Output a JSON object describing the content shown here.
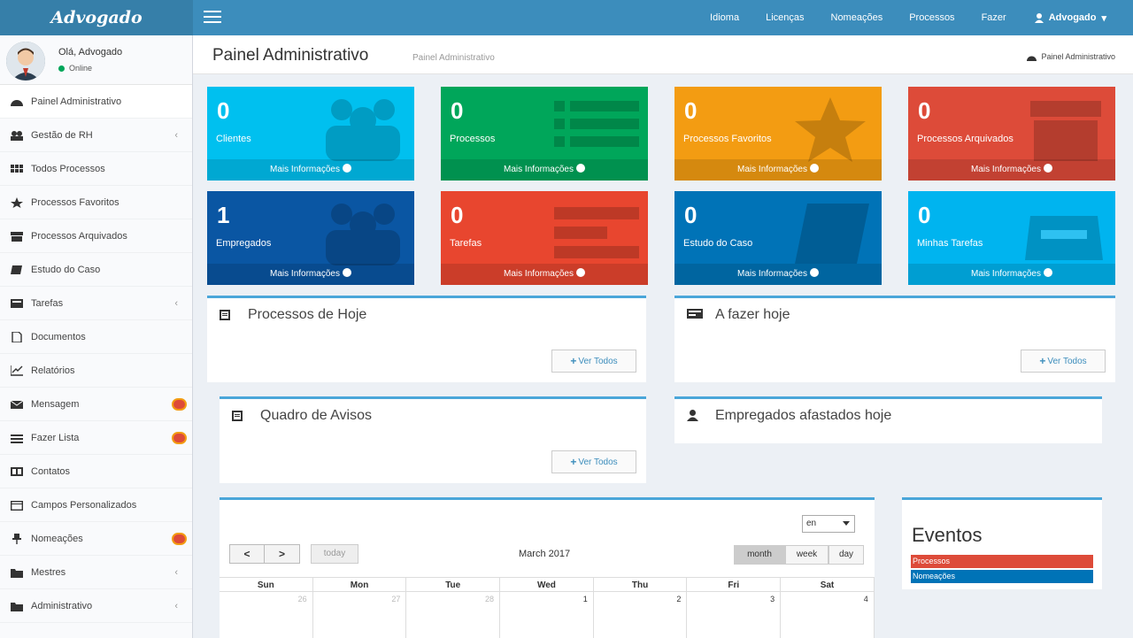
{
  "app": {
    "logo": "Advogado"
  },
  "topnav": {
    "links": [
      "Idioma",
      "Licenças",
      "Nomeações",
      "Processos",
      "Fazer"
    ],
    "user": "Advogado"
  },
  "sidebar": {
    "greeting": "Olá, Advogado",
    "status": "Online",
    "items": [
      {
        "label": "Painel Administrativo",
        "icon": "dashboard-icon"
      },
      {
        "label": "Gestão de RH",
        "icon": "users-icon",
        "chevron": "‹"
      },
      {
        "label": "Todos Processos",
        "icon": "grid-icon"
      },
      {
        "label": "Processos Favoritos",
        "icon": "star-icon"
      },
      {
        "label": "Processos Arquivados",
        "icon": "archive-icon"
      },
      {
        "label": "Estudo do Caso",
        "icon": "book-icon"
      },
      {
        "label": "Tarefas",
        "icon": "tasks-icon",
        "chevron": "‹"
      },
      {
        "label": "Documentos",
        "icon": "document-icon"
      },
      {
        "label": "Relatórios",
        "icon": "chart-icon"
      },
      {
        "label": "Mensagem",
        "icon": "envelope-icon"
      },
      {
        "label": "Fazer Lista",
        "icon": "list-icon"
      },
      {
        "label": "Contatos",
        "icon": "contacts-icon"
      },
      {
        "label": "Campos Personalizados",
        "icon": "form-icon"
      },
      {
        "label": "Nomeações",
        "icon": "pin-icon"
      },
      {
        "label": "Mestres",
        "icon": "folder-icon",
        "chevron": "‹"
      },
      {
        "label": "Administrativo",
        "icon": "folder-icon",
        "chevron": "‹"
      }
    ]
  },
  "header": {
    "title": "Painel Administrativo",
    "subtitle": "Painel Administrativo",
    "breadcrumb": "Painel Administrativo"
  },
  "boxes": [
    {
      "value": "0",
      "label": "Clientes",
      "more": "Mais Informações",
      "color": "#00c0ef"
    },
    {
      "value": "0",
      "label": "Processos",
      "more": "Mais Informações",
      "color": "#00a65a"
    },
    {
      "value": "0",
      "label": "Processos Favoritos",
      "more": "Mais Informações",
      "color": "#f39c12"
    },
    {
      "value": "0",
      "label": "Processos Arquivados",
      "more": "Mais Informações",
      "color": "#dd4b39"
    },
    {
      "value": "1",
      "label": "Empregados",
      "more": "Mais Informações",
      "color": "#0a56a3"
    },
    {
      "value": "0",
      "label": "Tarefas",
      "more": "Mais Informações",
      "color": "#e8462f"
    },
    {
      "value": "0",
      "label": "Estudo do Caso",
      "more": "Mais Informações",
      "color": "#0073b7"
    },
    {
      "value": "0",
      "label": "Minhas Tarefas",
      "more": "Mais Informações",
      "color": "#00b4ef"
    }
  ],
  "panels": {
    "processos_hoje": {
      "title": "Processos de Hoje",
      "button": "Ver Todos"
    },
    "a_fazer": {
      "title": "A fazer hoje",
      "button": "Ver Todos"
    },
    "avisos": {
      "title": "Quadro de Avisos",
      "button": "Ver Todos"
    },
    "afastados": {
      "title": "Empregados afastados hoje"
    }
  },
  "calendar": {
    "lang": "en",
    "title": "March 2017",
    "today": "today",
    "prev": "<",
    "next": ">",
    "views": [
      "month",
      "week",
      "day"
    ],
    "days": [
      "Sun",
      "Mon",
      "Tue",
      "Wed",
      "Thu",
      "Fri",
      "Sat"
    ],
    "first_week": [
      "26",
      "27",
      "28",
      "1",
      "2",
      "3",
      "4"
    ]
  },
  "events": {
    "title": "Eventos",
    "items": [
      {
        "label": "Processos",
        "color": "#dd4b39"
      },
      {
        "label": "Nomeações",
        "color": "#0073b7"
      }
    ]
  }
}
